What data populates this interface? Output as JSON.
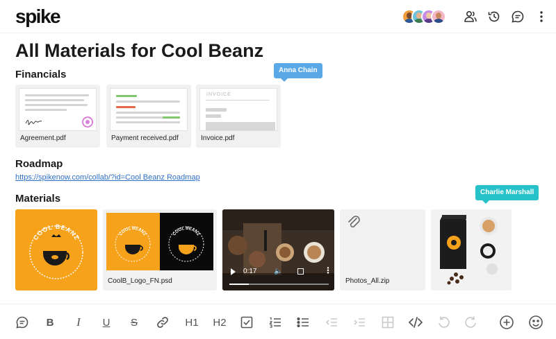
{
  "app": {
    "logo": "spike"
  },
  "header": {
    "avatars": [
      {
        "name": "avatar-1",
        "bg": "#f29e3d",
        "face": "#7a4a2a",
        "body": "#2b5b9a"
      },
      {
        "name": "avatar-2",
        "bg": "#6fc3d9",
        "face": "#e6b38a",
        "body": "#3b7d4f"
      },
      {
        "name": "avatar-3",
        "bg": "#c68be6",
        "face": "#f0c8a0",
        "body": "#5a3b8a"
      },
      {
        "name": "avatar-4",
        "bg": "#f4b7c7",
        "face": "#c68a5e",
        "body": "#2b4e8a"
      }
    ],
    "icons": [
      "participants-icon",
      "history-icon",
      "comments-icon",
      "more-vertical-icon"
    ]
  },
  "document": {
    "title": "All Materials for Cool Beanz",
    "sections": {
      "financials": {
        "title": "Financials",
        "files": [
          {
            "name": "Agreement.pdf"
          },
          {
            "name": "Payment received.pdf"
          },
          {
            "name": "Invoice.pdf",
            "thumb_label": "INVOICE"
          }
        ]
      },
      "roadmap": {
        "title": "Roadmap",
        "link": "https://spikenow.com/collab/?id=Cool Beanz Roadmap"
      },
      "materials": {
        "title": "Materials",
        "items": [
          {
            "type": "image",
            "logo_text": "COOL BEANZ"
          },
          {
            "type": "file",
            "name": "CoolB_Logo_FN.psd",
            "logo_text": "COOL BEANZ"
          },
          {
            "type": "video",
            "time": "0:17",
            "progress": 0.2
          },
          {
            "type": "file",
            "name": "Photos_All.zip"
          },
          {
            "type": "image",
            "description_icon": "coffee-product-photo"
          }
        ]
      }
    },
    "cursors": {
      "anna": {
        "label": "Anna Chain",
        "color": "#5aa9e6"
      },
      "charlie": {
        "label": "Charlie Marshall",
        "color": "#27c2c9"
      }
    }
  },
  "toolbar": {
    "h1": "H1",
    "h2": "H2",
    "bold": "B",
    "italic": "I",
    "underline": "U",
    "strike": "S"
  },
  "colors": {
    "brand_orange": "#f7a21b",
    "link": "#2f6fc7",
    "psd_black": "#0a0a0a"
  }
}
